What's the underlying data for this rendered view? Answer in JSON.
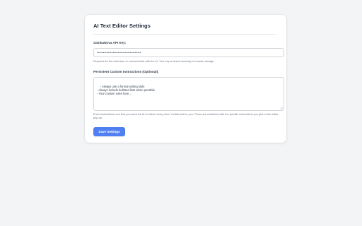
{
  "settings": {
    "title": "AI Text Editor Settings",
    "api_key": {
      "label": "SambaNova API Key:",
      "value": "••••••••••••••••••••••••••••••••••••",
      "help": "Required for the extension to communicate with the AI. Your key is stored securely in browser storage."
    },
    "instructions": {
      "label": "Persistent Custom Instructions (Optional):",
      "value": "- Always use a formal writing style\n- Always include bulleted lists when possible\n- Your custom rules here...",
      "help": "Enter instructions here that you want the AI to follow *every time* it edits text for you. These are combined with the specific instructions you give in the editor pop-up."
    },
    "save_label": "Save Settings"
  },
  "colors": {
    "accent": "#4f7ff0",
    "background": "#f3f4f6",
    "card": "#ffffff"
  }
}
